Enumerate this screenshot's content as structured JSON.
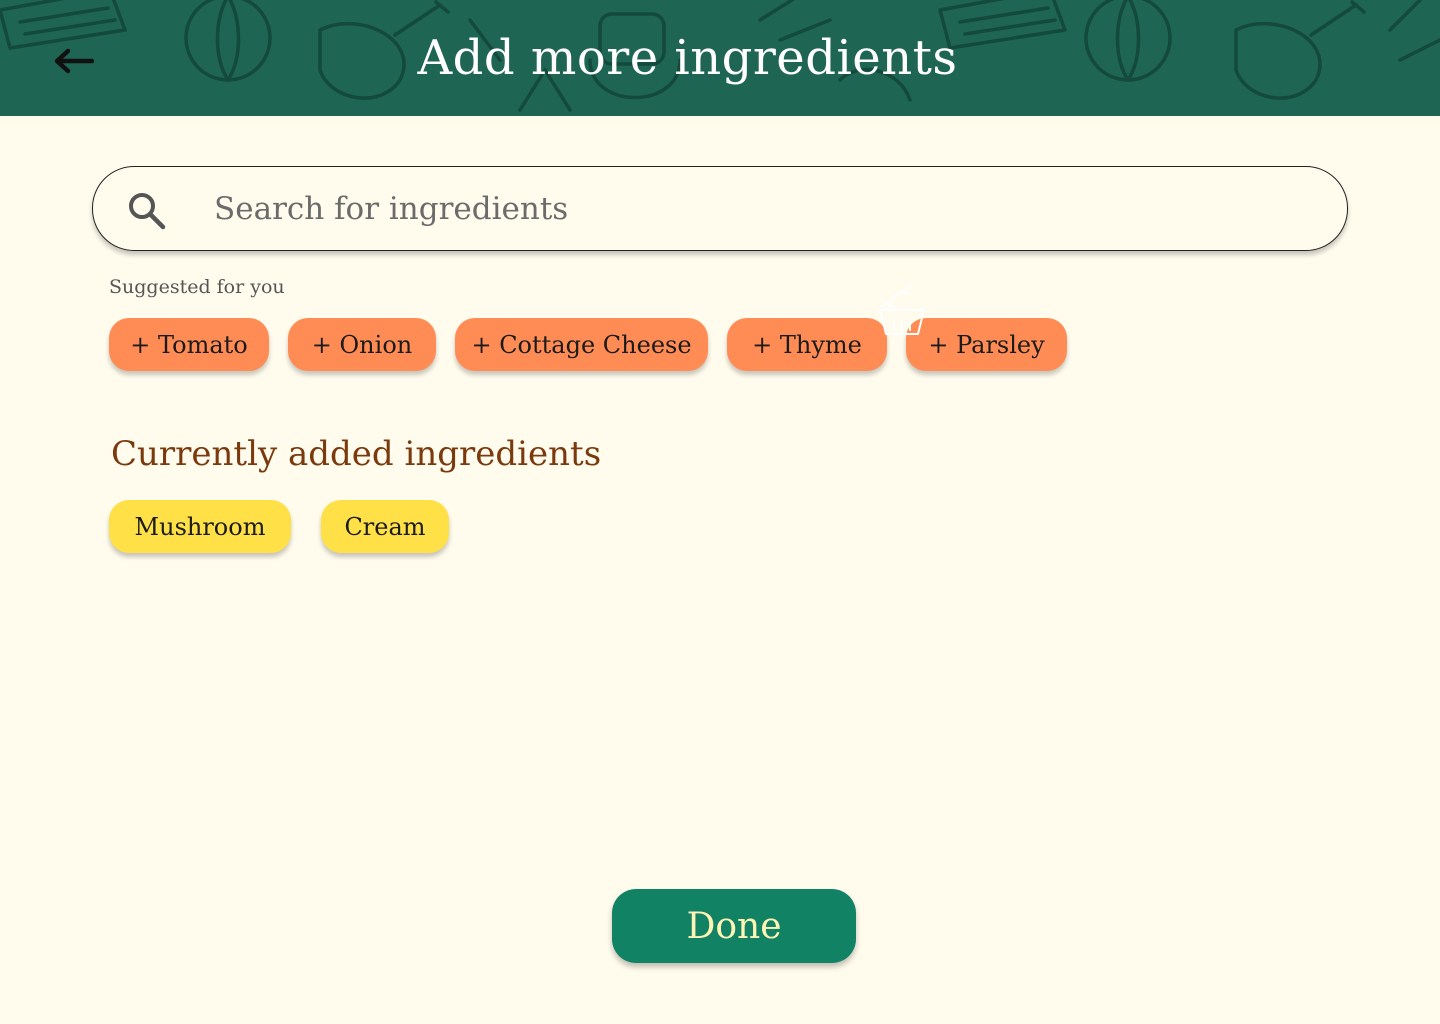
{
  "header": {
    "title": "Add more ingredients",
    "back_icon": "arrow-left-icon",
    "background_color": "#1E6553"
  },
  "search": {
    "placeholder": "Search for ingredients",
    "value": "",
    "icon": "search-icon"
  },
  "suggestions": {
    "label": "Suggested for you",
    "items": [
      {
        "label": "+ Tomato"
      },
      {
        "label": "+ Onion"
      },
      {
        "label": "+ Cottage Cheese"
      },
      {
        "label": "+ Thyme"
      },
      {
        "label": "+ Parsley"
      }
    ],
    "chip_color": "#FF8C54"
  },
  "current": {
    "heading": "Currently added ingredients",
    "items": [
      {
        "label": "Mushroom"
      },
      {
        "label": "Cream"
      }
    ],
    "chip_color": "#FFE047"
  },
  "footer": {
    "done_label": "Done",
    "button_color": "#128264"
  },
  "colors": {
    "page_background": "#FFFCEE",
    "heading_brown": "#7A3A0E"
  }
}
